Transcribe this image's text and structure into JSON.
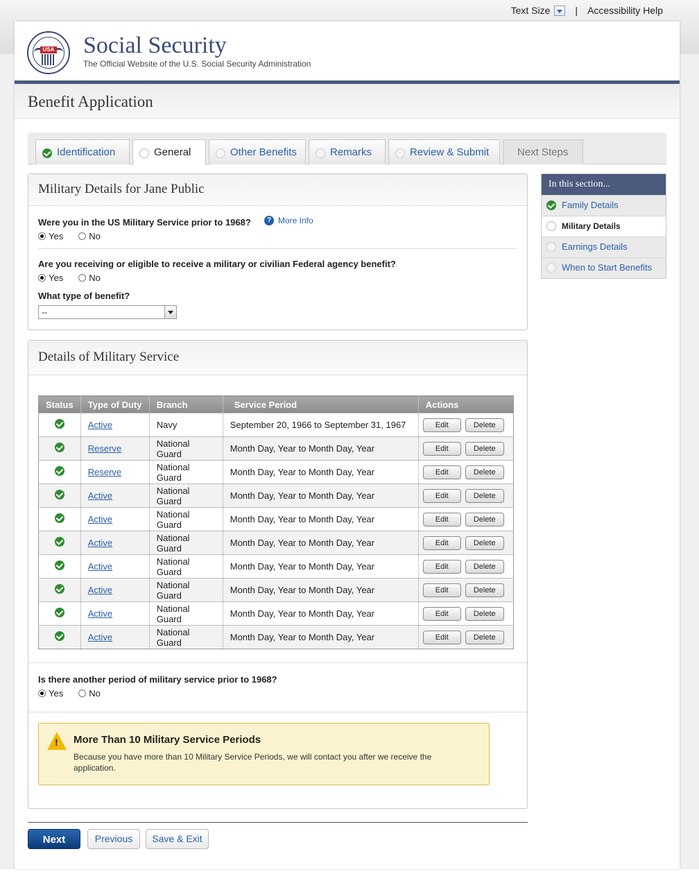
{
  "utility": {
    "text_size": "Text Size",
    "separator": "|",
    "accessibility": "Accessibility Help"
  },
  "header": {
    "title": "Social Security",
    "subtitle": "The Official Website of the U.S. Social Security Administration",
    "seal_text": "USA"
  },
  "page_title": "Benefit Application",
  "tabs": [
    {
      "label": "Identification",
      "state": "complete"
    },
    {
      "label": "General",
      "state": "current"
    },
    {
      "label": "Other Benefits",
      "state": "incomplete"
    },
    {
      "label": "Remarks",
      "state": "incomplete"
    },
    {
      "label": "Review & Submit",
      "state": "incomplete"
    },
    {
      "label": "Next Steps",
      "state": "disabled"
    }
  ],
  "military_panel": {
    "title": "Military Details for Jane Public",
    "q1": "Were you in the US Military Service prior to 1968?",
    "more_info": "More Info",
    "q2": "Are you receiving or eligible to receive a military or civilian Federal agency benefit?",
    "q3": "What type of benefit?",
    "select_value": "--",
    "yes": "Yes",
    "no": "No"
  },
  "service_panel": {
    "title": "Details of Military Service",
    "columns": [
      "Status",
      "Type of Duty",
      "Branch",
      "Service Period",
      "Actions"
    ],
    "rows": [
      {
        "duty": "Active",
        "branch": "Navy",
        "period": "September 20, 1966 to September 31, 1967"
      },
      {
        "duty": "Reserve",
        "branch": "National Guard",
        "period": "Month Day, Year to Month Day, Year"
      },
      {
        "duty": "Reserve",
        "branch": "National Guard",
        "period": "Month Day, Year to Month Day, Year"
      },
      {
        "duty": "Active",
        "branch": "National Guard",
        "period": "Month Day, Year to Month Day, Year"
      },
      {
        "duty": "Active",
        "branch": "National Guard",
        "period": "Month Day, Year to Month Day, Year"
      },
      {
        "duty": "Active",
        "branch": "National Guard",
        "period": "Month Day, Year to Month Day, Year"
      },
      {
        "duty": "Active",
        "branch": "National Guard",
        "period": "Month Day, Year to Month Day, Year"
      },
      {
        "duty": "Active",
        "branch": "National Guard",
        "period": "Month Day, Year to Month Day, Year"
      },
      {
        "duty": "Active",
        "branch": "National Guard",
        "period": "Month Day, Year to Month Day, Year"
      },
      {
        "duty": "Active",
        "branch": "National Guard",
        "period": "Month Day, Year to Month Day, Year"
      }
    ],
    "edit_label": "Edit",
    "delete_label": "Delete",
    "q_another": "Is there another period of military service prior to 1968?",
    "alert_title": "More Than 10 Military Service Periods",
    "alert_body": "Because you have more than 10 Military Service Periods, we will contact you after we receive the application."
  },
  "sidebar": {
    "title": "In this section...",
    "items": [
      {
        "label": "Family Details",
        "state": "complete"
      },
      {
        "label": "Military Details",
        "state": "current"
      },
      {
        "label": "Earnings Details",
        "state": "incomplete"
      },
      {
        "label": "When to Start Benefits",
        "state": "incomplete"
      }
    ]
  },
  "footer": {
    "next": "Next",
    "previous": "Previous",
    "save_exit": "Save & Exit"
  },
  "colors": {
    "brand": "#3b4a78",
    "link": "#2a5fa8",
    "complete": "#2f8c2f",
    "next_button": "#0b3a78"
  }
}
